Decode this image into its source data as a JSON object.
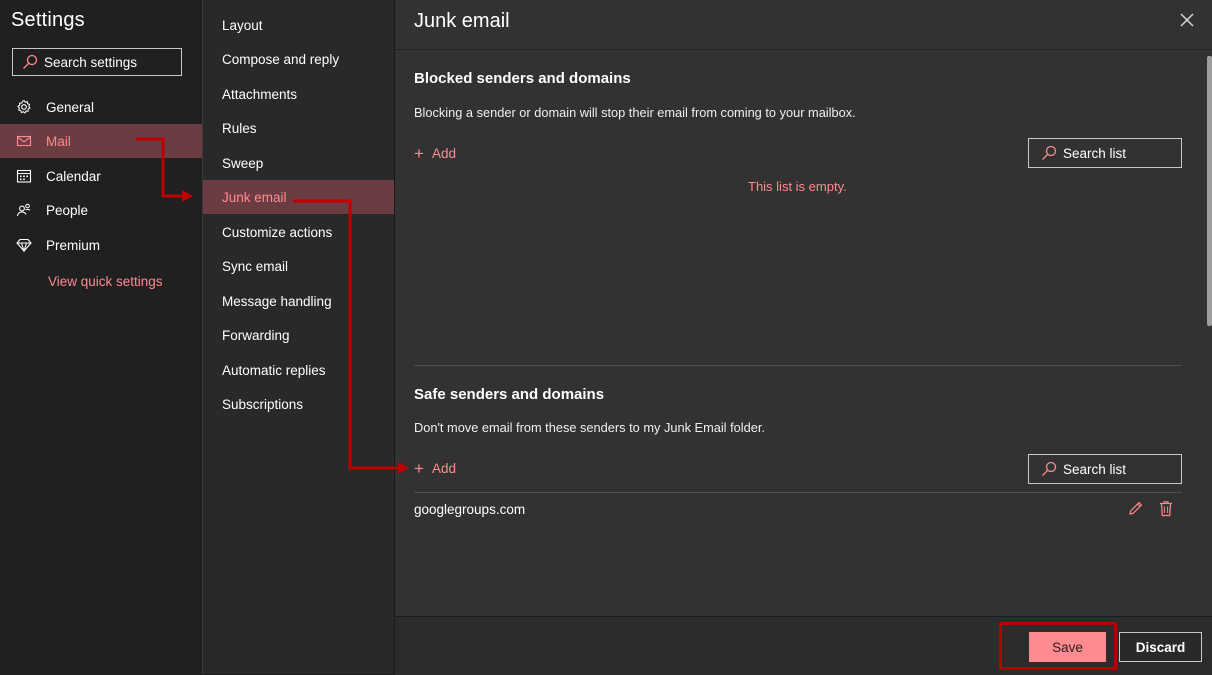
{
  "settings": {
    "title": "Settings",
    "search_placeholder": "Search settings"
  },
  "left_nav": {
    "items": [
      {
        "label": "General",
        "icon": "gear-icon"
      },
      {
        "label": "Mail",
        "icon": "mail-icon"
      },
      {
        "label": "Calendar",
        "icon": "calendar-icon"
      },
      {
        "label": "People",
        "icon": "people-icon"
      },
      {
        "label": "Premium",
        "icon": "diamond-icon"
      }
    ],
    "active": "Mail",
    "quick_settings": "View quick settings"
  },
  "sub_nav": {
    "items": [
      "Layout",
      "Compose and reply",
      "Attachments",
      "Rules",
      "Sweep",
      "Junk email",
      "Customize actions",
      "Sync email",
      "Message handling",
      "Forwarding",
      "Automatic replies",
      "Subscriptions"
    ],
    "active": "Junk email"
  },
  "panel": {
    "title": "Junk email",
    "blocked": {
      "title": "Blocked senders and domains",
      "description": "Blocking a sender or domain will stop their email from coming to your mailbox.",
      "add_label": "Add",
      "search_label": "Search list",
      "empty_text": "This list is empty."
    },
    "safe": {
      "title": "Safe senders and domains",
      "description": "Don't move email from these senders to my Junk Email folder.",
      "add_label": "Add",
      "search_label": "Search list",
      "entries": [
        "googlegroups.com"
      ]
    }
  },
  "footer": {
    "save_label": "Save",
    "discard_label": "Discard"
  },
  "colors": {
    "accent": "#ff8a8f",
    "active_bg": "#6b3c42",
    "annotation_red": "#b00000"
  }
}
